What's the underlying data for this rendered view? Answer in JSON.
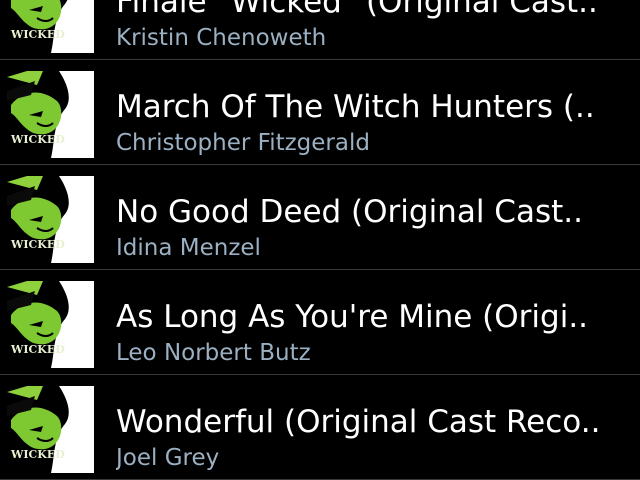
{
  "colors": {
    "background": "#000000",
    "title": "#ffffff",
    "artist": "#9bb0c2",
    "divider": "#3a3a3a",
    "album_green": "#7ec832"
  },
  "tracks": [
    {
      "title": "Finale \"Wicked\" (Original Cast..",
      "artist": "Kristin Chenoweth",
      "album_art": {
        "icon": "wicked-album-art-icon",
        "label": "WICKED"
      }
    },
    {
      "title": "March Of The Witch Hunters (..",
      "artist": "Christopher Fitzgerald",
      "album_art": {
        "icon": "wicked-album-art-icon",
        "label": "WICKED"
      }
    },
    {
      "title": "No Good Deed (Original Cast..",
      "artist": "Idina Menzel",
      "album_art": {
        "icon": "wicked-album-art-icon",
        "label": "WICKED"
      }
    },
    {
      "title": "As Long As You're Mine (Origi..",
      "artist": "Leo Norbert Butz",
      "album_art": {
        "icon": "wicked-album-art-icon",
        "label": "WICKED"
      }
    },
    {
      "title": "Wonderful (Original Cast Reco..",
      "artist": "Joel Grey",
      "album_art": {
        "icon": "wicked-album-art-icon",
        "label": "WICKED"
      }
    }
  ]
}
